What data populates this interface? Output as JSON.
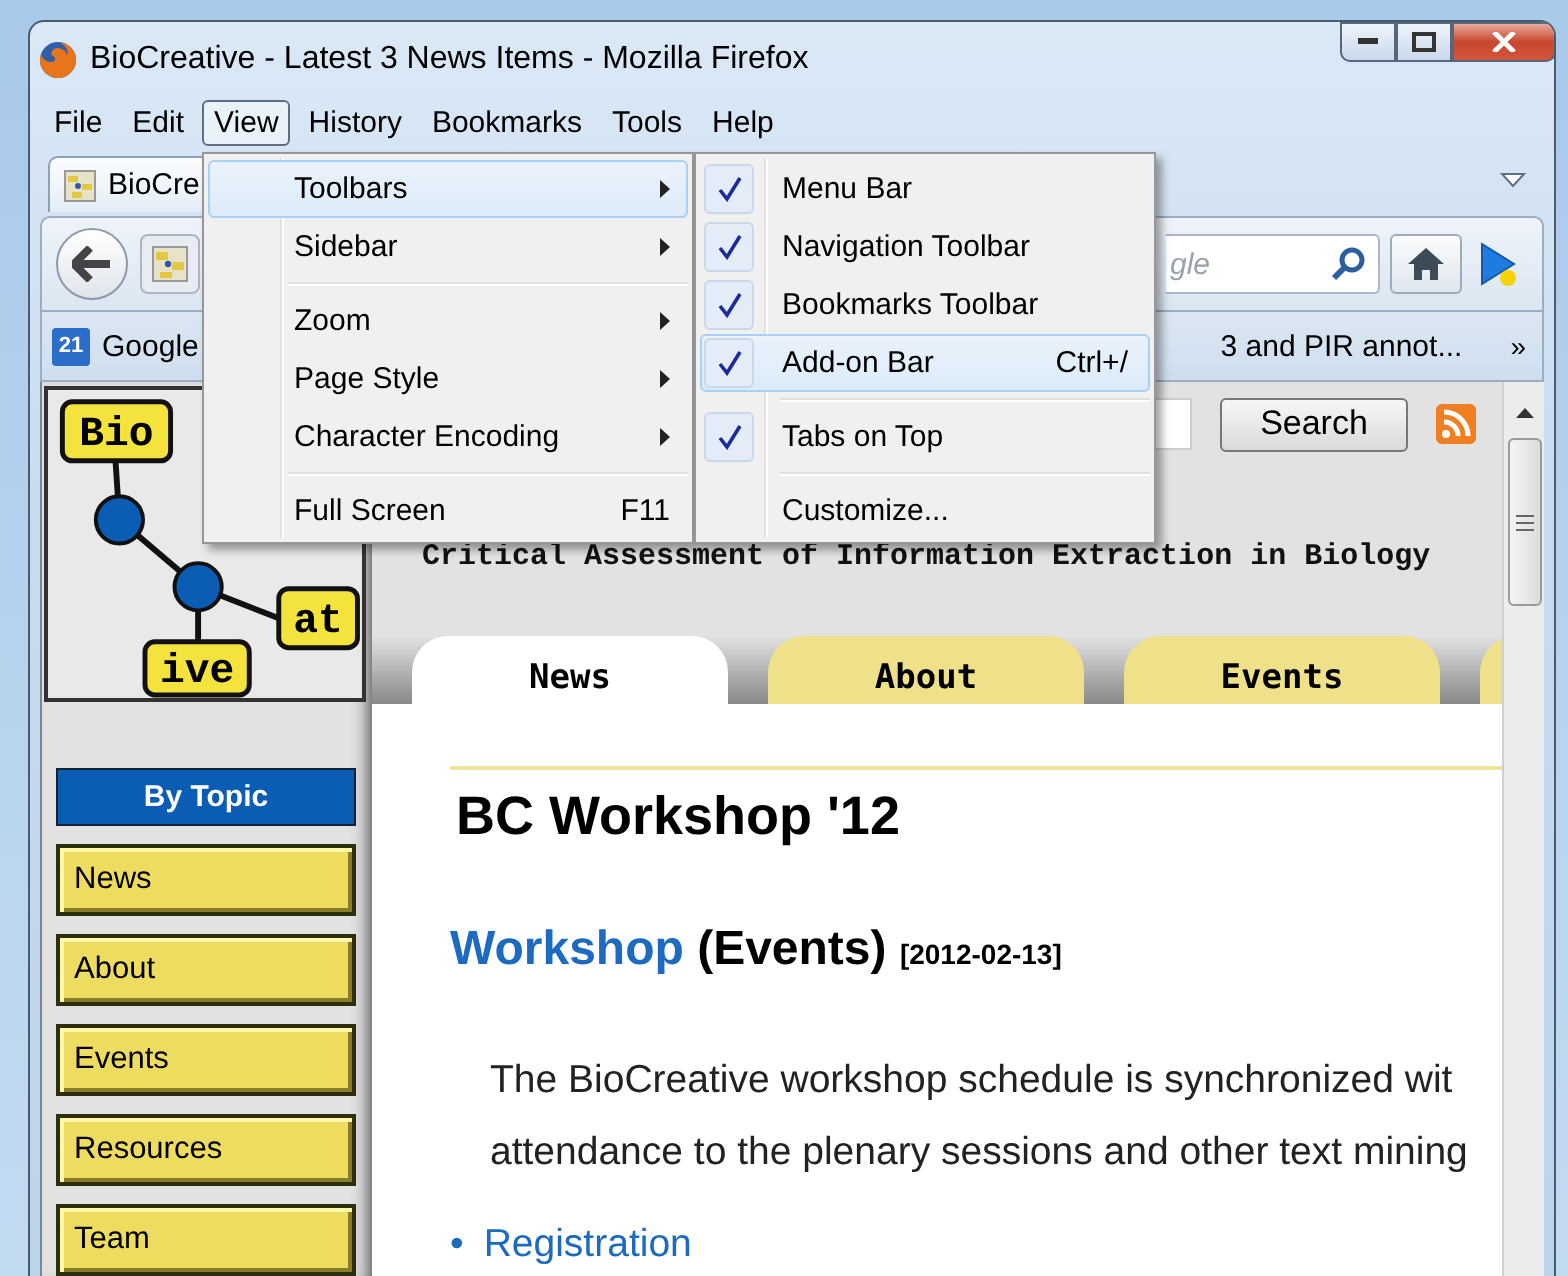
{
  "window": {
    "title": "BioCreative - Latest 3 News Items - Mozilla Firefox"
  },
  "menu_bar": [
    {
      "label": "File",
      "selected": false
    },
    {
      "label": "Edit",
      "selected": false
    },
    {
      "label": "View",
      "selected": true
    },
    {
      "label": "History",
      "selected": false
    },
    {
      "label": "Bookmarks",
      "selected": false
    },
    {
      "label": "Tools",
      "selected": false
    },
    {
      "label": "Help",
      "selected": false
    }
  ],
  "tabs": [
    {
      "label": "BioCre",
      "selected": true
    }
  ],
  "search_box": {
    "placeholder": "gle"
  },
  "bookmarks": [
    {
      "label": "Google",
      "icon_text": "21"
    },
    {
      "label": "3 and PIR annot..."
    }
  ],
  "bookmarks_overflow": "»",
  "view_menu": [
    {
      "kind": "item",
      "label": "Toolbars",
      "submenu": true,
      "selected": true
    },
    {
      "kind": "item",
      "label": "Sidebar",
      "submenu": true,
      "selected": false
    },
    {
      "kind": "separator"
    },
    {
      "kind": "item",
      "label": "Zoom",
      "submenu": true,
      "selected": false
    },
    {
      "kind": "item",
      "label": "Page Style",
      "submenu": true,
      "selected": false
    },
    {
      "kind": "item",
      "label": "Character Encoding",
      "submenu": true,
      "selected": false
    },
    {
      "kind": "separator"
    },
    {
      "kind": "item",
      "label": "Full Screen",
      "shortcut": "F11",
      "submenu": false,
      "selected": false
    }
  ],
  "toolbars_submenu": [
    {
      "kind": "item",
      "label": "Menu Bar",
      "checked": true,
      "selected": false
    },
    {
      "kind": "item",
      "label": "Navigation Toolbar",
      "checked": true,
      "selected": false
    },
    {
      "kind": "item",
      "label": "Bookmarks Toolbar",
      "checked": true,
      "selected": false
    },
    {
      "kind": "item",
      "label": "Add-on Bar",
      "shortcut": "Ctrl+/",
      "checked": true,
      "selected": true
    },
    {
      "kind": "separator"
    },
    {
      "kind": "item",
      "label": "Tabs on Top",
      "checked": true,
      "selected": false
    },
    {
      "kind": "separator"
    },
    {
      "kind": "item",
      "label": "Customize...",
      "checked": false,
      "selected": false
    }
  ],
  "page": {
    "logo": {
      "words": [
        "Bio",
        "at",
        "ive"
      ]
    },
    "search_button": "Search",
    "subtitle": "Critical Assessment of Information Extraction in Biology",
    "sidebar": {
      "heading": "By Topic",
      "items": [
        "News",
        "About",
        "Events",
        "Resources",
        "Team"
      ]
    },
    "page_tabs": [
      {
        "label": "News",
        "selected": true
      },
      {
        "label": "About",
        "selected": false
      },
      {
        "label": "Events",
        "selected": false
      }
    ],
    "article": {
      "title": "BC Workshop '12",
      "link": "Workshop",
      "category": "(Events)",
      "date": "[2012-02-13]",
      "paragraph_lines": [
        "The BioCreative workshop schedule is synchronized wit",
        "attendance to the plenary sessions and other text mining"
      ],
      "list_marker": "•",
      "list": [
        "Registration"
      ]
    }
  }
}
